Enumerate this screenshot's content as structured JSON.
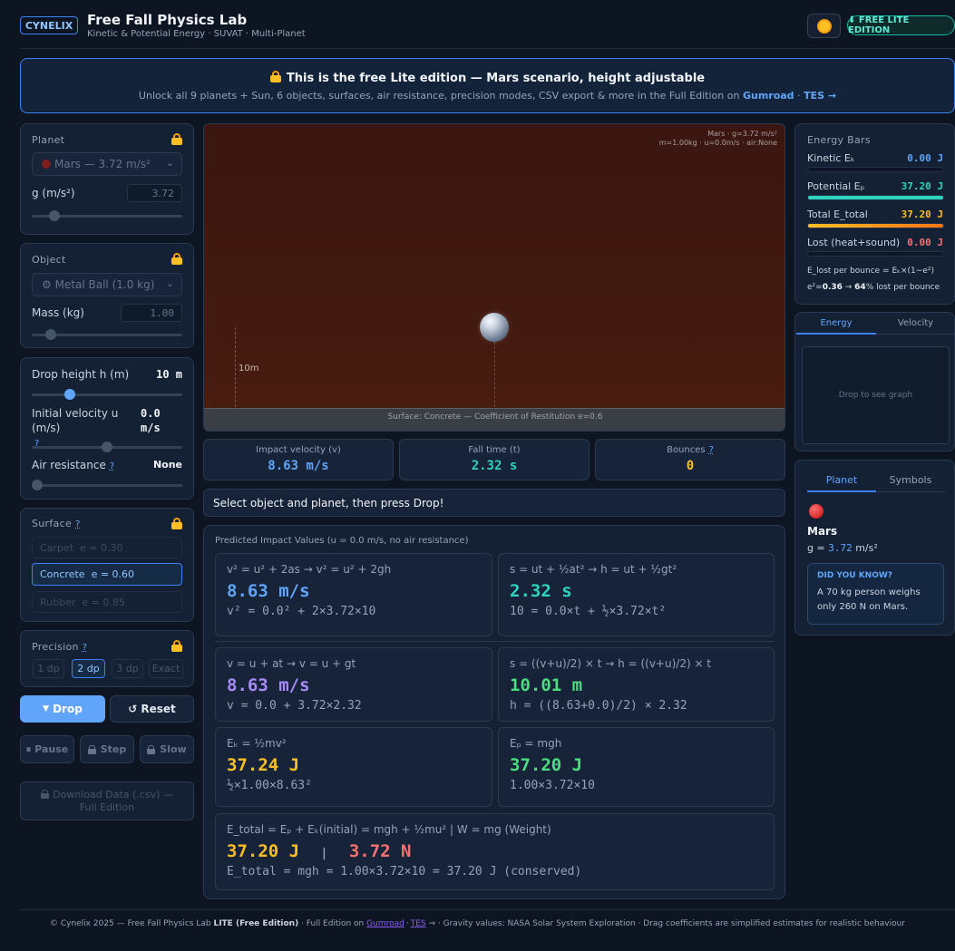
{
  "header": {
    "brand": "CYNELIX",
    "title": "Free Fall Physics Lab",
    "subtitle": "Kinetic & Potential Energy · SUVAT · Multi-Planet",
    "edition_badge": "⬇ FREE LITE EDITION"
  },
  "banner": {
    "title": "This is the free Lite edition — Mars scenario, height adjustable",
    "text": "Unlock all 9 planets + Sun, 6 objects, surfaces, air resistance, precision modes, CSV export & more in the Full Edition on",
    "link1": "Gumroad",
    "sep": "·",
    "link2": "TES →"
  },
  "planet_panel": {
    "label": "Planet",
    "select": "Mars — 3.72 m/s²",
    "g_label": "g (m/s²)",
    "g_value": "3.72",
    "g_slider_fraction": 0.17
  },
  "object_panel": {
    "label": "Object",
    "select": "⚙ Metal Ball (1.0 kg)",
    "mass_label": "Mass (kg)",
    "mass_value": "1.00",
    "mass_slider_fraction": 0.13
  },
  "params_panel": {
    "height_label": "Drop height h (m)",
    "height_value": "10 m",
    "height_fraction": 0.25,
    "velocity_label": "Initial velocity u (m/s)",
    "velocity_value": "0.0",
    "velocity_unit": "m/s",
    "velocity_fraction": 0.5,
    "air_label": "Air resistance",
    "air_value": "None",
    "air_fraction": 0.0,
    "help": "?"
  },
  "surface_panel": {
    "label": "Surface",
    "options": [
      {
        "name": "Carpet",
        "e": "e = 0.30"
      },
      {
        "name": "Concrete",
        "e": "e = 0.60"
      },
      {
        "name": "Rubber",
        "e": "e = 0.85"
      }
    ]
  },
  "precision_panel": {
    "label": "Precision",
    "options": [
      "1 dp",
      "2 dp",
      "3 dp",
      "Exact"
    ],
    "selected": "2 dp"
  },
  "controls": {
    "drop": "Drop",
    "reset": "Reset",
    "pause": "Pause",
    "step": "Step",
    "slow": "Slow",
    "download": "Download Data (.csv) — Full Edition"
  },
  "canvas": {
    "info_line1": "Mars · g=3.72 m/s²",
    "info_line2": "m=1.00kg · u=0.0m/s · air:None",
    "height_marker": "10m",
    "surface_caption": "Surface: Concrete — Coefficient of Restitution e=0.6"
  },
  "stats": {
    "impact_label": "Impact velocity (v)",
    "impact_value": "8.63 m/s",
    "time_label": "Fall time (t)",
    "time_value": "2.32 s",
    "bounces_label": "Bounces",
    "bounces_value": "0"
  },
  "status_message": "Select object and planet, then press Drop!",
  "predicted": {
    "title": "Predicted Impact Values (u = 0.0 m/s, no air resistance)",
    "f1": {
      "head": "v² = u² + 2as  →  v² = u² + 2gh",
      "big": "8.63 m/s",
      "sub": "v² = 0.0² + 2×3.72×10"
    },
    "f2": {
      "head": "s = ut + ½at²  →  h = ut + ½gt²",
      "big": "2.32 s",
      "sub": "10 = 0.0×t + ½×3.72×t²"
    },
    "f3": {
      "head": "v = u + at  →  v = u + gt",
      "big": "8.63 m/s",
      "sub": "v = 0.0 + 3.72×2.32"
    },
    "f4": {
      "head": "s = ((v+u)/2) × t  →  h = ((v+u)/2) × t",
      "big": "10.01 m",
      "sub": "h = ((8.63+0.0)/2) × 2.32"
    },
    "f5": {
      "head": "Eₖ = ½mv²",
      "big": "37.24 J",
      "sub": "½×1.00×8.63²"
    },
    "f6": {
      "head": "Eₚ = mgh",
      "big": "37.20 J",
      "sub": "1.00×3.72×10"
    },
    "f7": {
      "head": "E_total = Eₚ + Eₖ(initial) = mgh + ½mu²  |  W = mg (Weight)",
      "big1": "37.20 J",
      "sep": "|",
      "big2": "3.72 N",
      "sub": "E_total = mgh = 1.00×3.72×10 = 37.20 J (conserved)"
    }
  },
  "energy_bars": {
    "title": "Energy Bars",
    "bars": [
      {
        "label": "Kinetic Eₖ",
        "value": "0.00 J",
        "fraction": 0.0
      },
      {
        "label": "Potential Eₚ",
        "value": "37.20 J",
        "fraction": 1.0
      },
      {
        "label": "Total E_total",
        "value": "37.20 J",
        "fraction": 1.0
      },
      {
        "label": "Lost (heat+sound)",
        "value": "0.00 J",
        "fraction": 0.0
      }
    ],
    "note1": "E_lost per bounce = Eₖ×(1−e²)",
    "note2_pre": "e²=",
    "note2_a": "0.36",
    "note2_mid": " → ",
    "note2_b": "64",
    "note2_post": "% lost per bounce"
  },
  "graph_panel": {
    "tabs": [
      "Energy",
      "Velocity"
    ],
    "placeholder": "Drop to see graph"
  },
  "info_panel": {
    "tabs": [
      "Planet",
      "Symbols"
    ],
    "planet_name": "Mars",
    "g_prefix": "g = ",
    "g_value": "3.72",
    "g_unit": " m/s²",
    "dyk_title": "DID YOU KNOW?",
    "dyk_text": "A 70 kg person weighs only 260 N on Mars."
  },
  "footer": {
    "text1": "© Cynelix 2025 — Free Fall Physics Lab",
    "text_bold": "LITE (Free Edition)",
    "text2": "· Full Edition on",
    "link1": "Gumroad",
    "dot": "·",
    "link2": "TES",
    "text3": "→ · Gravity values: NASA Solar System Exploration · Drag coefficients are simplified estimates for realistic behaviour"
  },
  "colors": {
    "accent": "#60a5fa",
    "cyan": "#2dd4bf",
    "amber": "#fbbf24",
    "red": "#f87171",
    "purple": "#a78bfa",
    "green": "#4ade80"
  }
}
